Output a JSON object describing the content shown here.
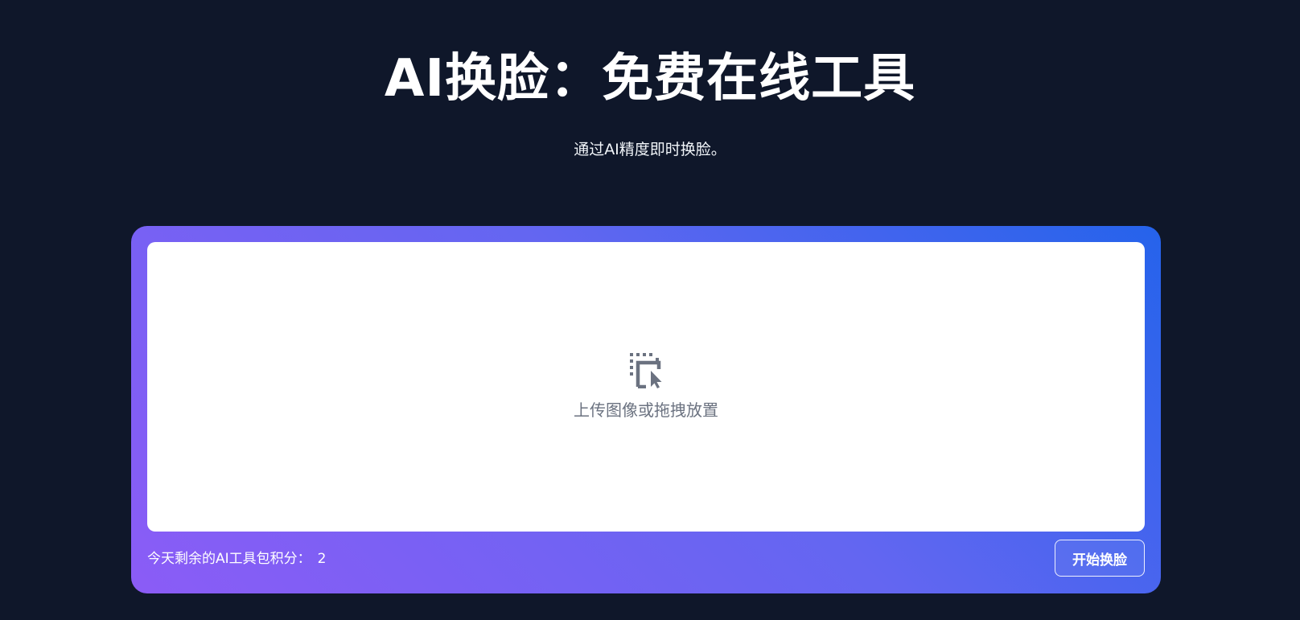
{
  "hero": {
    "title": "AI换脸：免费在线工具",
    "subtitle": "通过AI精度即时换脸。"
  },
  "upload": {
    "icon": "drag-select-icon",
    "prompt": "上传图像或拖拽放置"
  },
  "footer": {
    "credits_label": "今天剩余的AI工具包积分：",
    "credits_value": "2",
    "start_label": "开始换脸"
  },
  "colors": {
    "background": "#0f172a",
    "gradient_start": "#8b5cf6",
    "gradient_end": "#2563eb",
    "muted_text": "#6b7280",
    "icon": "#6b7280"
  }
}
